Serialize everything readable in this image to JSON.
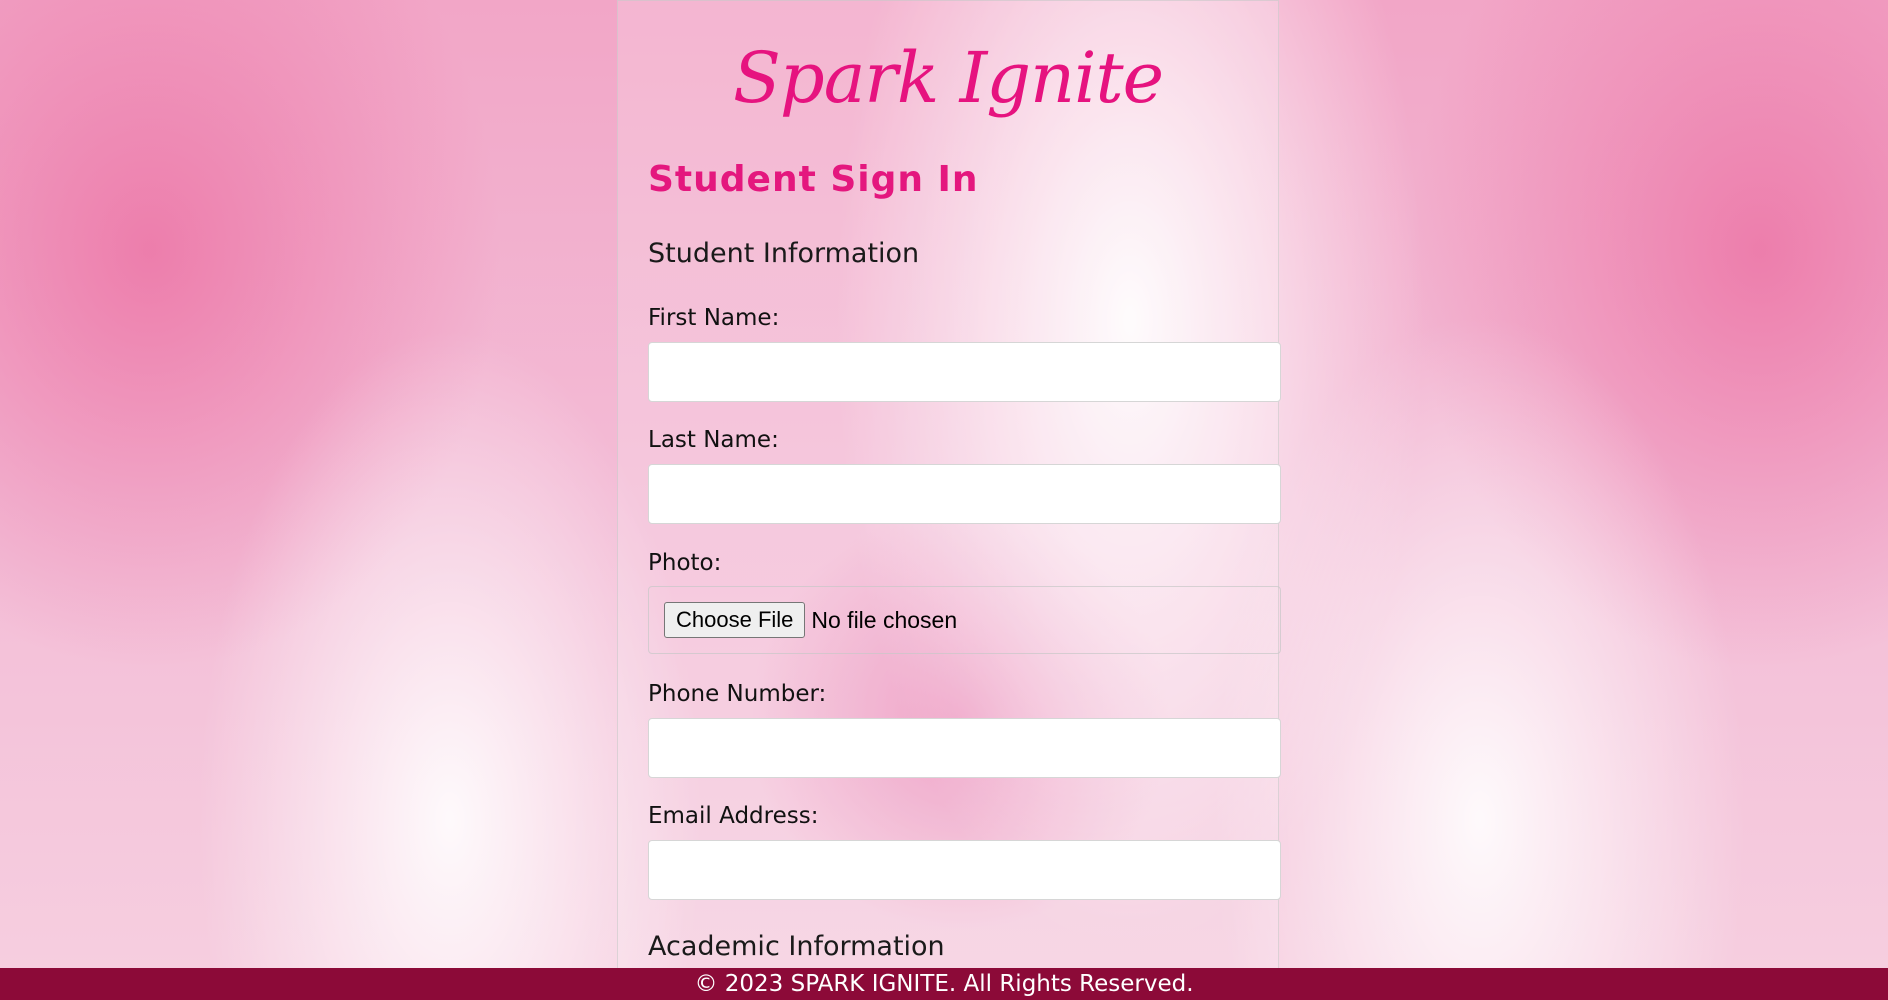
{
  "brand": "Spark Ignite",
  "page_title": "Student Sign In",
  "sections": {
    "student": "Student Information",
    "academic": "Academic Information"
  },
  "fields": {
    "first_name": {
      "label": "First Name:",
      "value": ""
    },
    "last_name": {
      "label": "Last Name:",
      "value": ""
    },
    "photo": {
      "label": "Photo:",
      "button": "Choose File",
      "status": "No file chosen"
    },
    "phone": {
      "label": "Phone Number:",
      "value": ""
    },
    "email": {
      "label": "Email Address:",
      "value": ""
    }
  },
  "footer": "© 2023 SPARK IGNITE. All Rights Reserved.",
  "colors": {
    "accent": "#e6137f",
    "footer_bg": "#8c0a38",
    "background": "#f2a6c7"
  }
}
